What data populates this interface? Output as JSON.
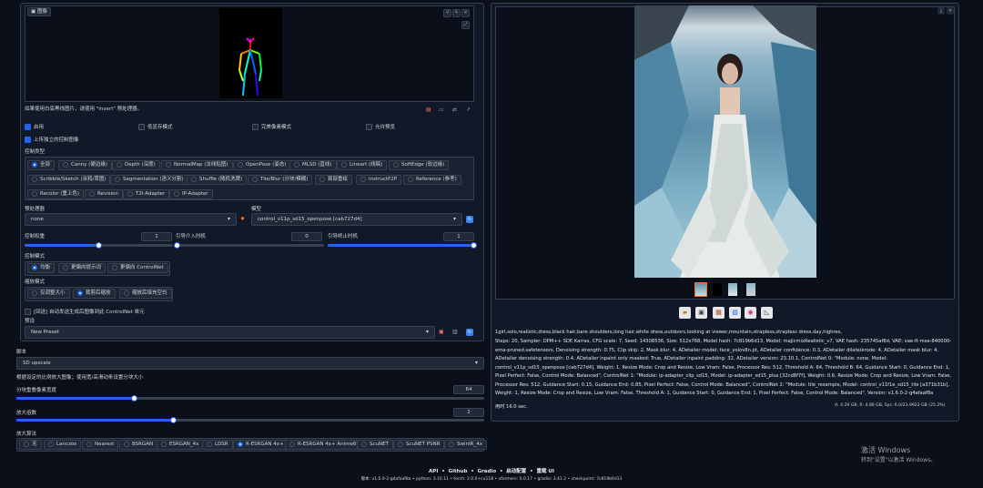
{
  "image_input": {
    "label": "图像",
    "footer_text": "如果使用白底黑线图片，请使用 \"invert\" 预处理器。"
  },
  "options": {
    "enable": "启用",
    "low_vram": "低显存模式",
    "pixel_perfect": "完美像素模式",
    "allow_preview": "允许预览",
    "upload_independent": "上传独立的控制图像"
  },
  "control_type": {
    "label": "控制类型",
    "items": [
      "全部",
      "Canny (硬边缘)",
      "Depth (深度)",
      "NormalMap (法线贴图)",
      "OpenPose (姿态)",
      "MLSD (直线)",
      "Lineart (线稿)",
      "SoftEdge (软边缘)",
      "Scribble/Sketch (涂鸦/草图)",
      "Segmentation (语义分割)",
      "Shuffle (随机洗牌)",
      "Tile/Blur (分块/模糊)",
      "局部重绘",
      "InstructP2P",
      "Reference (参考)",
      "Recolor (重上色)",
      "Revision",
      "T2I-Adapter",
      "IP-Adapter"
    ]
  },
  "preprocessor": {
    "label": "预处理器",
    "value": "none"
  },
  "model": {
    "label": "模型",
    "value": "control_v11p_sd15_openpose [cab727d4]"
  },
  "weights": {
    "weight_label": "控制权重",
    "weight_value": "1",
    "start_label": "引导介入时机",
    "start_value": "0",
    "end_label": "引导终止时机",
    "end_value": "1"
  },
  "control_mode": {
    "label": "控制模式",
    "items": [
      "均衡",
      "更偏向提示词",
      "更偏向 ControlNet"
    ]
  },
  "resize_mode": {
    "label": "缩放模式",
    "items": [
      "仅调整大小",
      "裁剪后缩放",
      "缩放后填充空白"
    ]
  },
  "batch_option": "[回送] 自动发送生成后图像到此 ControlNet 单元",
  "preset": {
    "label": "预设",
    "value": "New Preset"
  },
  "script": {
    "label": "脚本",
    "value": "SD upscale"
  },
  "upscale": {
    "hint": "根据设定的比例放大图像；使用宽/高滑动条设置分块大小",
    "overlap_label": "分块重叠像素宽度",
    "overlap_value": "64",
    "scale_label": "放大倍数",
    "scale_value": "2",
    "upscaler_label": "放大算法",
    "upscalers": [
      "无",
      "Lanczos",
      "Nearest",
      "BSRGAN",
      "ESRGAN_4x",
      "LDSR",
      "R-ESRGAN 4x+",
      "R-ESRGAN 4x+ Anime6B",
      "ScuNET",
      "ScuNET PSNR",
      "SwinIR_4x"
    ]
  },
  "output": {
    "prompt": "1girl,solo,realistic,dress,black hair,bare shoulders,long hair,white dress,outdoors,looking at viewer,mountain,strapless,strapless dress,day,highres,",
    "params": "Steps: 20, Sampler: DPM++ SDE Karras, CFG scale: 7, Seed: 14308536, Size: 512x768, Model hash: 7c819b6d13, Model: majicmixRealistic_v7, VAE hash: 235745af8d, VAE: vae-ft-mse-840000-ema-pruned.safetensors, Denoising strength: 0.75, Clip skip: 2, Mask blur: 4, ADetailer model: face_yolov8n.pt, ADetailer confidence: 0.3, ADetailer dilate/erode: 4, ADetailer mask blur: 4, ADetailer denoising strength: 0.4, ADetailer inpaint only masked: True, ADetailer inpaint padding: 32, ADetailer version: 23.10.1, ControlNet 0: \"Module: none, Model: control_v11p_sd15_openpose [cab727d4], Weight: 1, Resize Mode: Crop and Resize, Low Vram: False, Processor Res: 512, Threshold A: 64, Threshold B: 64, Guidance Start: 0, Guidance End: 1, Pixel Perfect: False, Control Mode: Balanced\", ControlNet 1: \"Module: ip-adapter_clip_sd15, Model: ip-adapter_sd15_plus [32cd8f7f], Weight: 0.6, Resize Mode: Crop and Resize, Low Vram: False, Processor Res: 512, Guidance Start: 0.15, Guidance End: 0.85, Pixel Perfect: False, Control Mode: Balanced\", ControlNet 2: \"Module: tile_resample, Model: control_v11f1e_sd15_tile [a371b31b], Weight: 1, Resize Mode: Crop and Resize, Low Vram: False, Threshold A: 1, Guidance Start: 0, Guidance End: 1, Pixel Perfect: False, Control Mode: Balanced\", Version: v1.6.0-2-g4afaaf8a",
    "time": "用时 16.0 sec.",
    "mem": "A: 4.29 GB, R: 4.86 GB, Sys: 6.0/23.9922 GB (25.2%)"
  },
  "footer": {
    "links": [
      "API",
      "Github",
      "Gradio",
      "启动配置",
      "重载 UI"
    ],
    "version": "版本: v1.6.0-2-g4afaaf8a  •  python: 3.10.11  •  torch: 2.0.0+cu118  •  xformers: 0.0.17  •  gradio: 3.41.2  •  checkpoint: 7c819b6d13"
  },
  "watermark": {
    "line1": "激活 Windows",
    "line2": "转到\"设置\"以激活 Windows。"
  }
}
